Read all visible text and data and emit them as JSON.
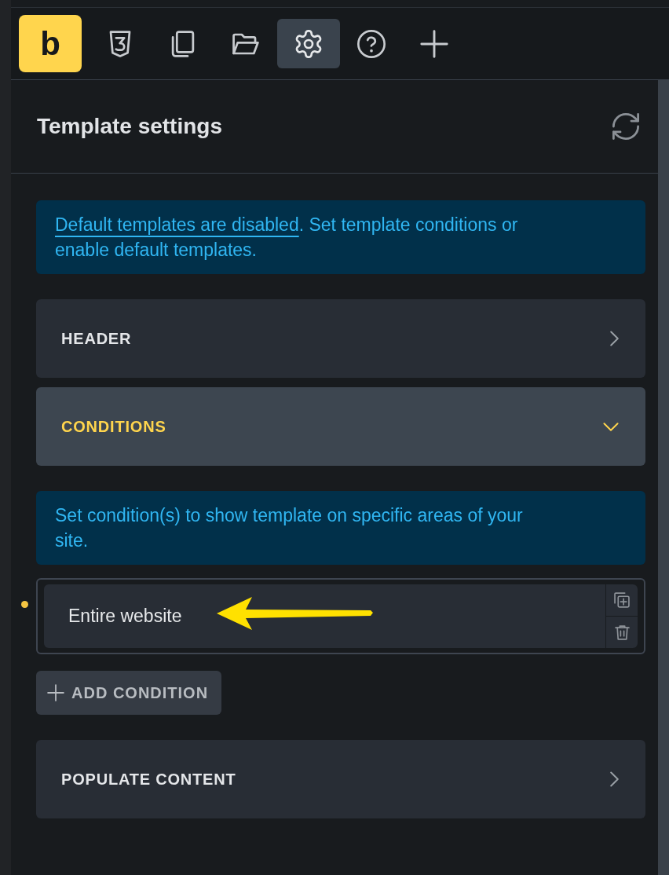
{
  "toolbar": {
    "logo": "b",
    "tools": [
      {
        "kind": "css",
        "selected": false
      },
      {
        "kind": "pages",
        "selected": false
      },
      {
        "kind": "folder",
        "selected": false
      },
      {
        "kind": "settings",
        "selected": true
      },
      {
        "kind": "help",
        "selected": false
      },
      {
        "kind": "add",
        "selected": false
      }
    ]
  },
  "panel": {
    "title": "Template settings"
  },
  "notice": {
    "link": "Default templates are disabled",
    "text": ". Set template conditions or enable default templates."
  },
  "sections": [
    {
      "title": "HEADER",
      "expanded": false
    },
    {
      "title": "CONDITIONS",
      "expanded": true,
      "hint": "Set condition(s) to show template on specific areas of your site.",
      "conditions": [
        {
          "label": "Entire website"
        }
      ],
      "add_button": "ADD CONDITION"
    },
    {
      "title": "POPULATE CONTENT",
      "expanded": false
    }
  ]
}
